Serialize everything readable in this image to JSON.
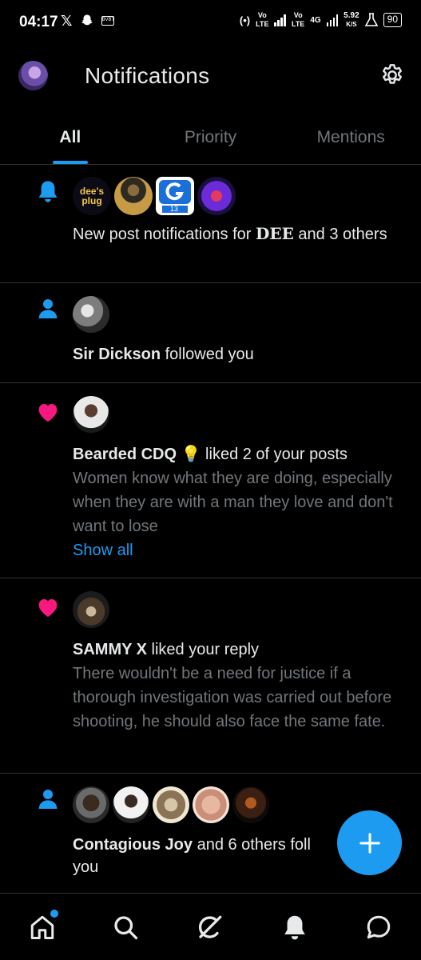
{
  "status_bar": {
    "time": "04:17",
    "icons": [
      "x-logo-icon",
      "snapchat-icon",
      "app-badge-icon"
    ],
    "app_badge_text": "BVBT",
    "hotspot_text": "(•)",
    "vo_lte_1": "Vo\nLTE",
    "vo_lte_2": "Vo\nLTE",
    "net_type": "4G",
    "speed": "5.92",
    "speed_unit": "K/S",
    "battery": "90"
  },
  "header": {
    "title": "Notifications",
    "avatar": "profile-avatar",
    "settings_icon": "gear-icon"
  },
  "tabs": [
    {
      "label": "All",
      "active": true
    },
    {
      "label": "Priority",
      "active": false
    },
    {
      "label": "Mentions",
      "active": false
    }
  ],
  "notifications": [
    {
      "type": "bell",
      "icon": "bell-icon",
      "avatars": [
        "dees-plug-avatar",
        "athlete-avatar",
        "app-13-avatar",
        "sports-logo-avatar"
      ],
      "dees_plug_text": "dee's plug",
      "app_number": "13",
      "text_prefix": "New post notifications for ",
      "text_name": "𝐃𝐄𝐄",
      "text_suffix": " and 3 others"
    },
    {
      "type": "follow",
      "icon": "person-icon",
      "avatars": [
        "sir-dickson-avatar"
      ],
      "name": "Sir Dickson",
      "action": " followed you"
    },
    {
      "type": "like",
      "icon": "heart-icon",
      "avatars": [
        "bearded-cdq-avatar"
      ],
      "name": "Bearded CDQ 💡",
      "action": " liked 2 of your posts",
      "quote": "Women know what they are doing, especially when they are with a man they love and don't want to lose",
      "show_all": "Show all"
    },
    {
      "type": "like",
      "icon": "heart-icon",
      "avatars": [
        "sammy-x-avatar"
      ],
      "name": "SAMMY X",
      "action": " liked your reply",
      "quote": "There wouldn't be a need for justice if a thorough investigation was carried out before shooting, he should also face the same fate."
    },
    {
      "type": "follow",
      "icon": "person-icon",
      "avatars": [
        "user-avatar-1",
        "user-avatar-2",
        "user-avatar-3",
        "user-avatar-4",
        "user-avatar-5"
      ],
      "name": "Contagious Joy",
      "action": " and 6 others followed you",
      "visible_line1_suffix": " and 6 others foll",
      "visible_line2": "you"
    }
  ],
  "fab": {
    "icon": "plus-icon"
  },
  "bottom_nav": [
    {
      "icon": "home-icon",
      "has_dot": true
    },
    {
      "icon": "search-icon"
    },
    {
      "icon": "grok-icon"
    },
    {
      "icon": "bell-icon",
      "active": true
    },
    {
      "icon": "messages-icon"
    }
  ],
  "colors": {
    "accent": "#1d9bf0",
    "like": "#f91880",
    "text_primary": "#e7e9ea",
    "text_secondary": "#71767b",
    "divider": "#2f3336",
    "background": "#000000"
  }
}
